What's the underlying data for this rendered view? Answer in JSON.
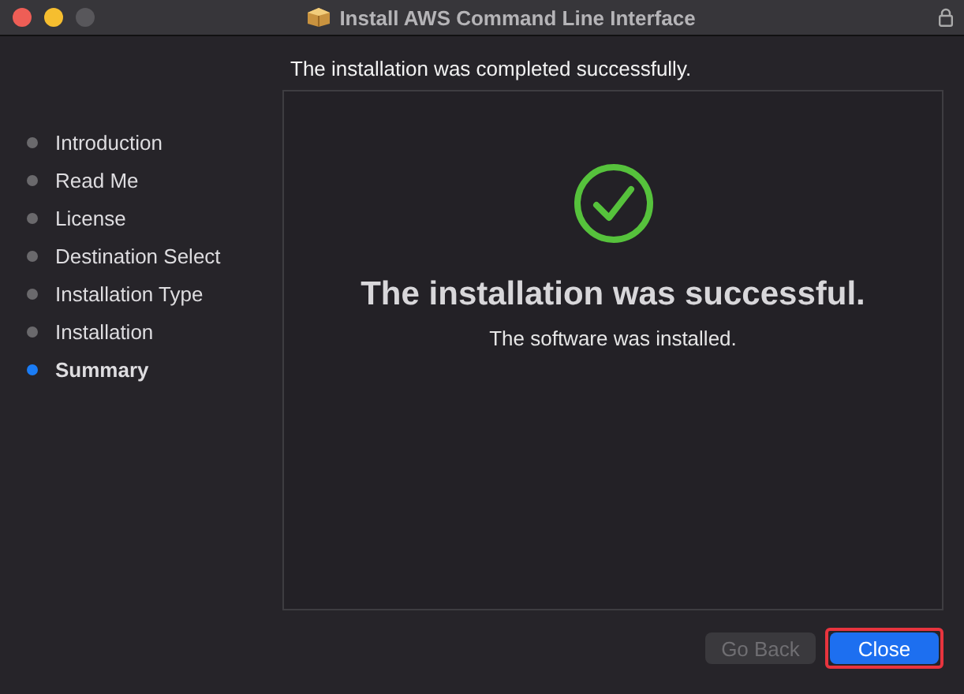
{
  "window": {
    "title": "Install AWS Command Line Interface",
    "locked": true
  },
  "heading": "The installation was completed successfully.",
  "steps": [
    {
      "label": "Introduction",
      "selected": false
    },
    {
      "label": "Read Me",
      "selected": false
    },
    {
      "label": "License",
      "selected": false
    },
    {
      "label": "Destination Select",
      "selected": false
    },
    {
      "label": "Installation Type",
      "selected": false
    },
    {
      "label": "Installation",
      "selected": false
    },
    {
      "label": "Summary",
      "selected": true
    }
  ],
  "result": {
    "title": "The installation was successful.",
    "message": "The software was installed."
  },
  "buttons": [
    {
      "label": "Go Back",
      "kind": "secondary",
      "disabled": true,
      "highlighted": false
    },
    {
      "label": "Close",
      "kind": "primary",
      "disabled": false,
      "highlighted": true
    }
  ]
}
